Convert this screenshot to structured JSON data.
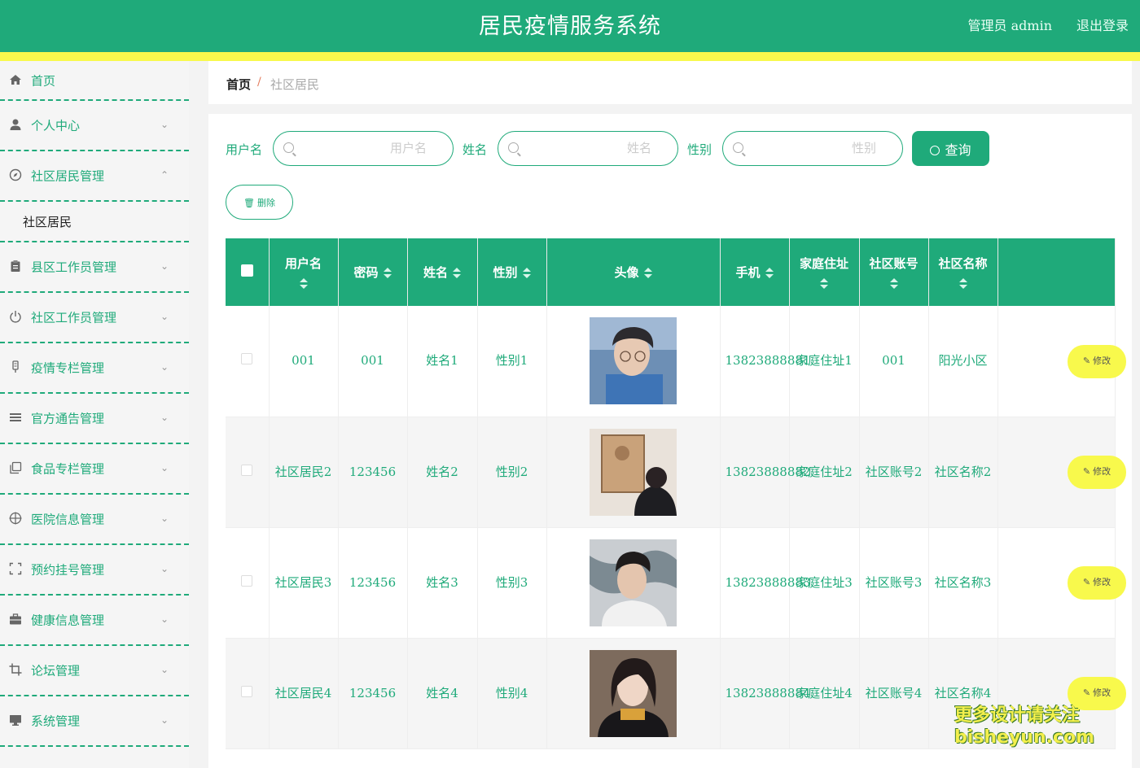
{
  "header": {
    "title": "居民疫情服务系统",
    "user": "管理员 admin",
    "logout": "退出登录"
  },
  "colors": {
    "primary": "#1faa7a",
    "accent": "#f8f94c"
  },
  "sidebar": {
    "items": [
      {
        "label": "首页",
        "icon": "home-icon"
      },
      {
        "label": "个人中心",
        "icon": "user-icon"
      },
      {
        "label": "社区居民管理",
        "icon": "compass-icon",
        "expanded": true,
        "children": [
          "社区居民"
        ]
      },
      {
        "label": "县区工作员管理",
        "icon": "clipboard-icon"
      },
      {
        "label": "社区工作员管理",
        "icon": "power-icon"
      },
      {
        "label": "疫情专栏管理",
        "icon": "thermometer-icon"
      },
      {
        "label": "官方通告管理",
        "icon": "list-icon"
      },
      {
        "label": "食品专栏管理",
        "icon": "copy-icon"
      },
      {
        "label": "医院信息管理",
        "icon": "crosshair-icon"
      },
      {
        "label": "预约挂号管理",
        "icon": "fullscreen-icon"
      },
      {
        "label": "健康信息管理",
        "icon": "briefcase-icon"
      },
      {
        "label": "论坛管理",
        "icon": "crop-icon"
      },
      {
        "label": "系统管理",
        "icon": "monitor-icon"
      }
    ]
  },
  "breadcrumb": {
    "home": "首页",
    "separator": "/",
    "current": "社区居民"
  },
  "filters": {
    "username_label": "用户名",
    "username_placeholder": "用户名",
    "name_label": "姓名",
    "name_placeholder": "姓名",
    "gender_label": "性别",
    "gender_placeholder": "性别",
    "query_button": "查询",
    "delete_button": "删除"
  },
  "table": {
    "columns": [
      "用户名",
      "密码",
      "姓名",
      "性别",
      "头像",
      "手机",
      "家庭住址",
      "社区账号",
      "社区名称"
    ],
    "edit_label": "修改",
    "rows": [
      {
        "username": "001",
        "password": "001",
        "name": "姓名1",
        "gender": "性别1",
        "phone": "13823888881",
        "address": "家庭住址1",
        "account": "001",
        "community": "阳光小区"
      },
      {
        "username": "社区居民2",
        "password": "123456",
        "name": "姓名2",
        "gender": "性别2",
        "phone": "13823888882",
        "address": "家庭住址2",
        "account": "社区账号2",
        "community": "社区名称2"
      },
      {
        "username": "社区居民3",
        "password": "123456",
        "name": "姓名3",
        "gender": "性别3",
        "phone": "13823888883",
        "address": "家庭住址3",
        "account": "社区账号3",
        "community": "社区名称3"
      },
      {
        "username": "社区居民4",
        "password": "123456",
        "name": "姓名4",
        "gender": "性别4",
        "phone": "13823888884",
        "address": "家庭住址4",
        "account": "社区账号4",
        "community": "社区名称4"
      }
    ]
  },
  "watermark": {
    "line1": "更多设计请关注",
    "line2": "bisheyun.com"
  }
}
